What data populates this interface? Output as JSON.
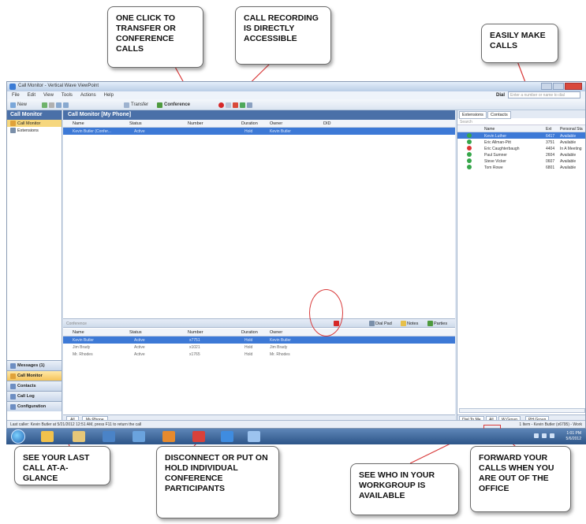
{
  "window": {
    "title": "Call Monitor - Vertical Wave ViewPoint",
    "menu": [
      "File",
      "Edit",
      "View",
      "Tools",
      "Actions",
      "Help"
    ],
    "dial_label": "Dial",
    "dial_placeholder": "Enter a number or name to dial"
  },
  "toolbar": {
    "new_label": "New",
    "transfer_label": "Transfer",
    "conference_label": "Conference"
  },
  "left_nav": {
    "header": "Call Monitor",
    "items": [
      "Call Monitor",
      "Extensions"
    ],
    "buttons": [
      "Messages (1)",
      "Call Monitor",
      "Contacts",
      "Call Log",
      "Configuration"
    ]
  },
  "main": {
    "header": "Call Monitor [My Phone]",
    "columns": [
      "Name",
      "Status",
      "Number",
      "Duration",
      "Owner",
      "DID"
    ],
    "top_rows": [
      {
        "name": "Kevin Butler (Confer...",
        "status": "Active",
        "number": "",
        "duration": "Hold",
        "owner": "Kevin Butler",
        "did": ""
      }
    ],
    "conference_label": "Conference",
    "conf_buttons": [
      "Dial Pad",
      "Notes",
      "Parties"
    ],
    "bottom_columns": [
      "Name",
      "Status",
      "Number",
      "Duration",
      "Owner"
    ],
    "bottom_rows": [
      {
        "name": "Kevin Butler",
        "status": "Active",
        "number": "x7751",
        "duration": "Hold",
        "owner": "Kevin Butler"
      },
      {
        "name": "Jim Brady",
        "status": "Active",
        "number": "x1021",
        "duration": "Hold",
        "owner": "Jim Brady"
      },
      {
        "name": "Mr. Rhodes",
        "status": "Active",
        "number": "x1765",
        "duration": "Hold",
        "owner": "Mr. Rhodes"
      }
    ],
    "tabs": [
      "All",
      "My Phone"
    ]
  },
  "right_panel": {
    "tabs": [
      "Extensions",
      "Contacts"
    ],
    "search_placeholder": "Search",
    "columns": [
      "Name",
      "Ext",
      "Personal Sta"
    ],
    "rows": [
      {
        "name": "Kevin Luther",
        "ext": "6417",
        "status": "Available"
      },
      {
        "name": "Eric Allman-Pitt",
        "ext": "3751",
        "status": "Available"
      },
      {
        "name": "Eric Caughterbaugh",
        "ext": "4404",
        "status": "In A Meeting"
      },
      {
        "name": "Paul Sumner",
        "ext": "2604",
        "status": "Available"
      },
      {
        "name": "Steve Vicker",
        "ext": "0607",
        "status": "Available"
      },
      {
        "name": "Tom Rowe",
        "ext": "6801",
        "status": "Available"
      }
    ],
    "bottom_tabs": [
      "Dial To Me",
      "All",
      "W Group",
      "PH Group"
    ]
  },
  "status_bar": {
    "left": "Last caller: Kevin Butler at 5/21/2012 12:51 AM, press F11 to return the call",
    "right": "1 Item - Kevin Butler (x6795) - Work"
  },
  "taskbar": {
    "time": "1:01 PM",
    "date": "5/6/2012"
  },
  "callouts": {
    "transfer": "ONE CLICK TO TRANSFER OR CONFERENCE CALLS",
    "recording": "CALL RECORDING IS DIRECTLY ACCESSIBLE",
    "make_calls": "EASILY MAKE CALLS",
    "last_call": "SEE YOUR LAST CALL AT-A-GLANCE",
    "disconnect": "DISCONNECT OR PUT ON HOLD INDIVIDUAL CONFERENCE PARTICIPANTS",
    "workgroup": "SEE WHO IN YOUR WORKGROUP IS AVAILABLE",
    "forward": "FORWARD YOUR CALLS WHEN YOU ARE OUT OF THE OFFICE"
  },
  "colors": {
    "header_blue": "#4a70a8",
    "selected_row": "#3d79d6",
    "highlight_red": "#d93a3a",
    "nav_selected": "#f6d77e"
  }
}
